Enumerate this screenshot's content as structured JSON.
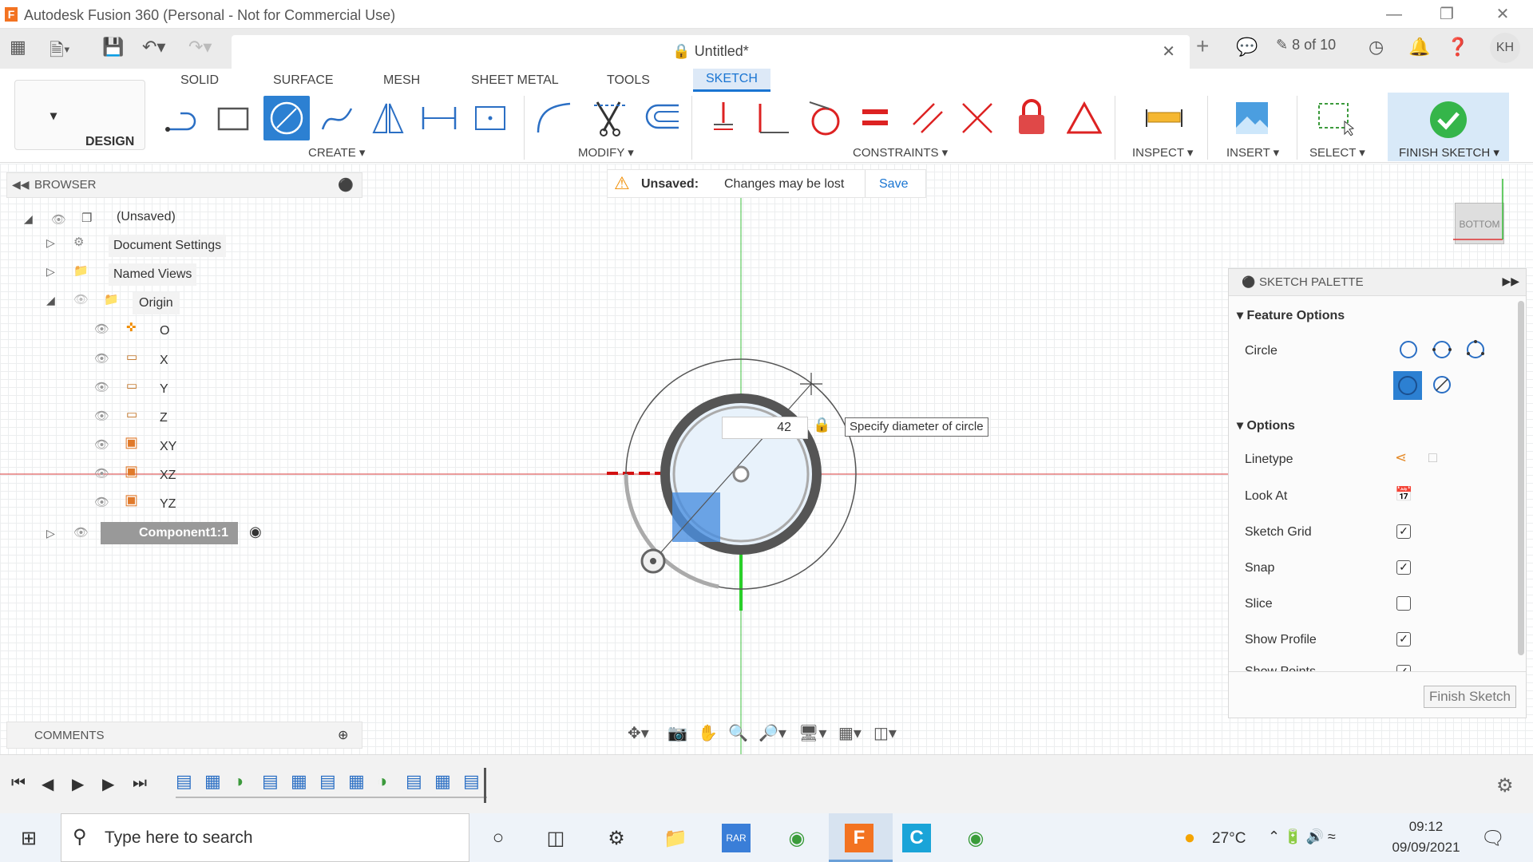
{
  "window": {
    "title": "Autodesk Fusion 360 (Personal - Not for Commercial Use)"
  },
  "document": {
    "tab_title": "Untitled*",
    "job_status": "8 of 10",
    "user_initials": "KH"
  },
  "workspace": {
    "label": "DESIGN"
  },
  "tabs": [
    "SOLID",
    "SURFACE",
    "MESH",
    "SHEET METAL",
    "TOOLS",
    "SKETCH"
  ],
  "groups": {
    "create": "CREATE",
    "modify": "MODIFY",
    "constraints": "CONSTRAINTS",
    "inspect": "INSPECT",
    "insert": "INSERT",
    "select": "SELECT",
    "finish": "FINISH SKETCH"
  },
  "banner": {
    "title": "Unsaved:",
    "message": "Changes may be lost",
    "save": "Save"
  },
  "browser": {
    "title": "BROWSER",
    "root": "(Unsaved)",
    "items": [
      "Document Settings",
      "Named Views",
      "Origin"
    ],
    "origin_items": [
      "O",
      "X",
      "Y",
      "Z",
      "XY",
      "XZ",
      "YZ"
    ],
    "component": "Component1:1"
  },
  "canvas": {
    "diameter_value": "42",
    "tooltip": "Specify diameter of circle",
    "viewcube": "BOTTOM"
  },
  "palette": {
    "title": "SKETCH PALETTE",
    "feature_options": "Feature Options",
    "circle_label": "Circle",
    "options": "Options",
    "rows": [
      {
        "label": "Linetype"
      },
      {
        "label": "Look At"
      },
      {
        "label": "Sketch Grid",
        "checked": true
      },
      {
        "label": "Snap",
        "checked": true
      },
      {
        "label": "Slice",
        "checked": false
      },
      {
        "label": "Show Profile",
        "checked": true
      },
      {
        "label": "Show Points",
        "checked": true
      }
    ],
    "finish_button": "Finish Sketch"
  },
  "comments": {
    "title": "COMMENTS"
  },
  "taskbar": {
    "search_placeholder": "Type here to search",
    "weather": "27°C",
    "time": "09:12",
    "date": "09/09/2021"
  }
}
